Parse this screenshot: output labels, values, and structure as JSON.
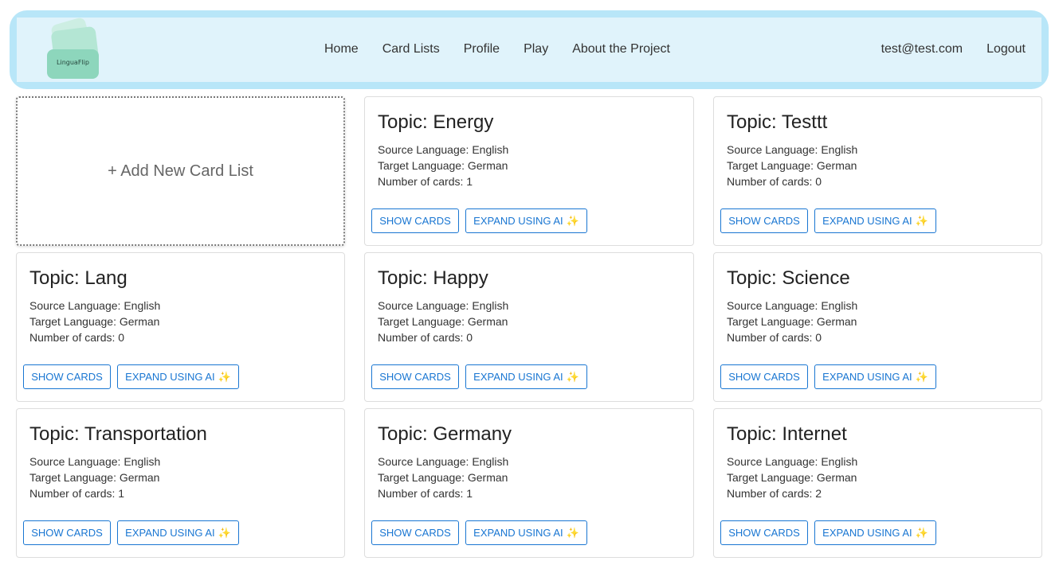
{
  "brand": {
    "logo_text": "LinguaFlip"
  },
  "nav": {
    "links": [
      "Home",
      "Card Lists",
      "Profile",
      "Play",
      "About the Project"
    ],
    "user_email": "test@test.com",
    "logout_label": "Logout"
  },
  "add_card": {
    "label": "+ Add New Card List"
  },
  "labels": {
    "show_cards": "SHOW CARDS",
    "expand_ai": "EXPAND USING AI",
    "sparkle_icon": "✨"
  },
  "card_lists": [
    {
      "topic": "Topic: Energy",
      "source": "Source Language: English",
      "target": "Target Language: German",
      "count": "Number of cards: 1"
    },
    {
      "topic": "Topic: Testtt",
      "source": "Source Language: English",
      "target": "Target Language: German",
      "count": "Number of cards: 0"
    },
    {
      "topic": "Topic: Lang",
      "source": "Source Language: English",
      "target": "Target Language: German",
      "count": "Number of cards: 0"
    },
    {
      "topic": "Topic: Happy",
      "source": "Source Language: English",
      "target": "Target Language: German",
      "count": "Number of cards: 0"
    },
    {
      "topic": "Topic: Science",
      "source": "Source Language: English",
      "target": "Target Language: German",
      "count": "Number of cards: 0"
    },
    {
      "topic": "Topic: Transportation",
      "source": "Source Language: English",
      "target": "Target Language: German",
      "count": "Number of cards: 1"
    },
    {
      "topic": "Topic: Germany",
      "source": "Source Language: English",
      "target": "Target Language: German",
      "count": "Number of cards: 1"
    },
    {
      "topic": "Topic: Internet",
      "source": "Source Language: English",
      "target": "Target Language: German",
      "count": "Number of cards: 2"
    }
  ],
  "colors": {
    "navbar_outer": "#b8e6f8",
    "navbar_inner": "#e0f3fb",
    "button_accent": "#1976d2",
    "logo_green": "#8dd6bc"
  }
}
